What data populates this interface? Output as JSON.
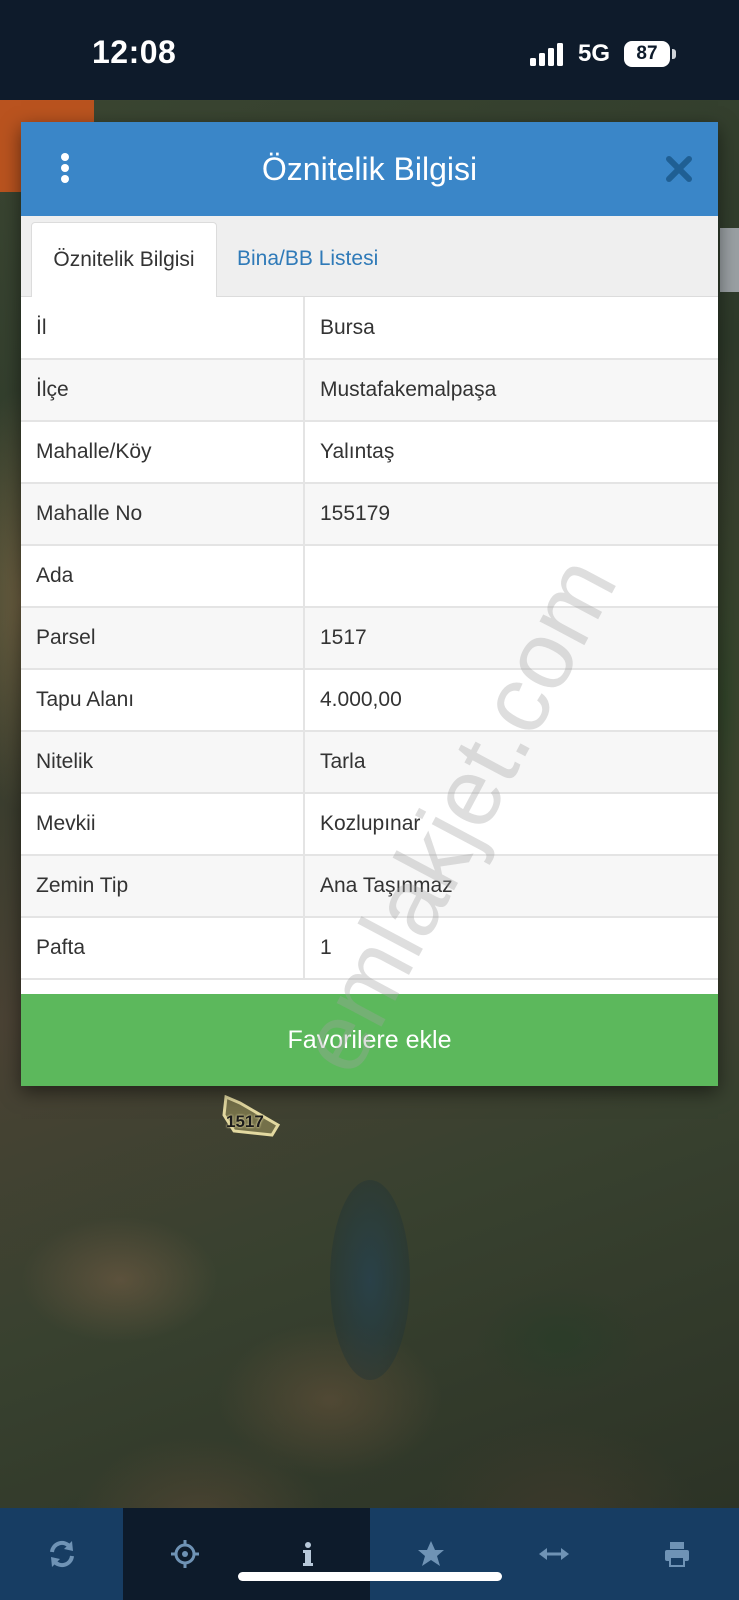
{
  "status_bar": {
    "time": "12:08",
    "network": "5G",
    "battery": "87"
  },
  "map": {
    "parcel_label": "1517"
  },
  "modal": {
    "title": "Öznitelik Bilgisi",
    "tabs": [
      {
        "label": "Öznitelik Bilgisi",
        "active": true
      },
      {
        "label": "Bina/BB Listesi",
        "active": false
      }
    ],
    "rows": [
      {
        "key": "İl",
        "value": "Bursa"
      },
      {
        "key": "İlçe",
        "value": "Mustafakemalpaşa"
      },
      {
        "key": "Mahalle/Köy",
        "value": "Yalıntaş"
      },
      {
        "key": "Mahalle No",
        "value": "155179"
      },
      {
        "key": "Ada",
        "value": ""
      },
      {
        "key": "Parsel",
        "value": "1517"
      },
      {
        "key": "Tapu Alanı",
        "value": "4.000,00"
      },
      {
        "key": "Nitelik",
        "value": "Tarla"
      },
      {
        "key": "Mevkii",
        "value": "Kozlupınar"
      },
      {
        "key": "Zemin Tip",
        "value": "Ana Taşınmaz"
      },
      {
        "key": "Pafta",
        "value": "1"
      }
    ],
    "favorite_button": "Favorilere ekle"
  },
  "watermark": "emlakjet.com",
  "toolbar": {
    "buttons": [
      {
        "icon": "refresh-icon"
      },
      {
        "icon": "locate-icon"
      },
      {
        "icon": "info-icon"
      },
      {
        "icon": "star-icon"
      },
      {
        "icon": "measure-icon"
      },
      {
        "icon": "print-icon"
      }
    ]
  },
  "colors": {
    "header_blue": "#3a86c8",
    "tab_link": "#2f7ab8",
    "favorite_green": "#5cb85c",
    "toolbar": "#173d63",
    "status_bar": "#0e1b2b"
  }
}
